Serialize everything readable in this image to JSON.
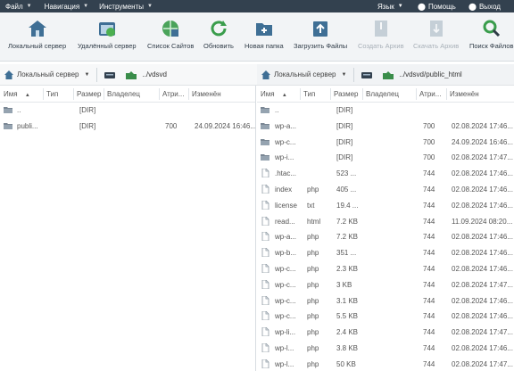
{
  "menubar": {
    "file": "Файл",
    "navigation": "Навигация",
    "tools": "Инструменты",
    "language": "Язык",
    "help": "Помощь",
    "exit": "Выход"
  },
  "toolbar": {
    "local_server": "Локальный сервер",
    "remote_server": "Удалённый сервер",
    "site_list": "Список Сайтов",
    "refresh": "Обновить",
    "new_folder": "Новая папка",
    "upload_files": "Загрузить Файлы",
    "create_archive": "Создать Архив",
    "download_archive": "Скачать Архив",
    "search_files": "Поиск Файлов"
  },
  "left": {
    "server_select": "Локальный сервер",
    "path": "../vdsvd",
    "headers": {
      "name": "Имя",
      "type": "Тип",
      "size": "Размер",
      "owner": "Владелец",
      "attr": "Атри...",
      "modified": "Изменён"
    },
    "rows": [
      {
        "name": "..",
        "type": "",
        "size": "[DIR]",
        "owner": "",
        "attr": "",
        "modified": "",
        "kind": "folder"
      },
      {
        "name": "publi...",
        "type": "",
        "size": "[DIR]",
        "owner": "",
        "attr": "700",
        "modified": "24.09.2024 16:46...",
        "kind": "folder"
      }
    ]
  },
  "right": {
    "server_select": "Локальный сервер",
    "path": "../vdsvd/public_html",
    "headers": {
      "name": "Имя",
      "type": "Тип",
      "size": "Размер",
      "owner": "Владелец",
      "attr": "Атри...",
      "modified": "Изменён"
    },
    "rows": [
      {
        "name": "..",
        "type": "",
        "size": "[DIR]",
        "attr": "",
        "modified": "",
        "kind": "folder"
      },
      {
        "name": "wp-a...",
        "type": "",
        "size": "[DIR]",
        "attr": "700",
        "modified": "02.08.2024 17:46...",
        "kind": "folder"
      },
      {
        "name": "wp-c...",
        "type": "",
        "size": "[DIR]",
        "attr": "700",
        "modified": "24.09.2024 16:46...",
        "kind": "folder"
      },
      {
        "name": "wp-i...",
        "type": "",
        "size": "[DIR]",
        "attr": "700",
        "modified": "02.08.2024 17:47...",
        "kind": "folder"
      },
      {
        "name": ".htac...",
        "type": "",
        "size": "523 ...",
        "attr": "744",
        "modified": "02.08.2024 17:46...",
        "kind": "file"
      },
      {
        "name": "index",
        "type": "php",
        "size": "405 ...",
        "attr": "744",
        "modified": "02.08.2024 17:46...",
        "kind": "file"
      },
      {
        "name": "license",
        "type": "txt",
        "size": "19.4 ...",
        "attr": "744",
        "modified": "02.08.2024 17:46...",
        "kind": "file"
      },
      {
        "name": "read...",
        "type": "html",
        "size": "7.2 KB",
        "attr": "744",
        "modified": "11.09.2024 08:20...",
        "kind": "file"
      },
      {
        "name": "wp-a...",
        "type": "php",
        "size": "7.2 KB",
        "attr": "744",
        "modified": "02.08.2024 17:46...",
        "kind": "file"
      },
      {
        "name": "wp-b...",
        "type": "php",
        "size": "351 ...",
        "attr": "744",
        "modified": "02.08.2024 17:46...",
        "kind": "file"
      },
      {
        "name": "wp-c...",
        "type": "php",
        "size": "2.3 KB",
        "attr": "744",
        "modified": "02.08.2024 17:46...",
        "kind": "file"
      },
      {
        "name": "wp-c...",
        "type": "php",
        "size": "3 KB",
        "attr": "744",
        "modified": "02.08.2024 17:47...",
        "kind": "file"
      },
      {
        "name": "wp-c...",
        "type": "php",
        "size": "3.1 KB",
        "attr": "744",
        "modified": "02.08.2024 17:46...",
        "kind": "file"
      },
      {
        "name": "wp-c...",
        "type": "php",
        "size": "5.5 KB",
        "attr": "744",
        "modified": "02.08.2024 17:46...",
        "kind": "file"
      },
      {
        "name": "wp-li...",
        "type": "php",
        "size": "2.4 KB",
        "attr": "744",
        "modified": "02.08.2024 17:47...",
        "kind": "file"
      },
      {
        "name": "wp-l...",
        "type": "php",
        "size": "3.8 KB",
        "attr": "744",
        "modified": "02.08.2024 17:46...",
        "kind": "file"
      },
      {
        "name": "wp-l...",
        "type": "php",
        "size": "50 KB",
        "attr": "744",
        "modified": "02.08.2024 17:47...",
        "kind": "file"
      }
    ]
  }
}
